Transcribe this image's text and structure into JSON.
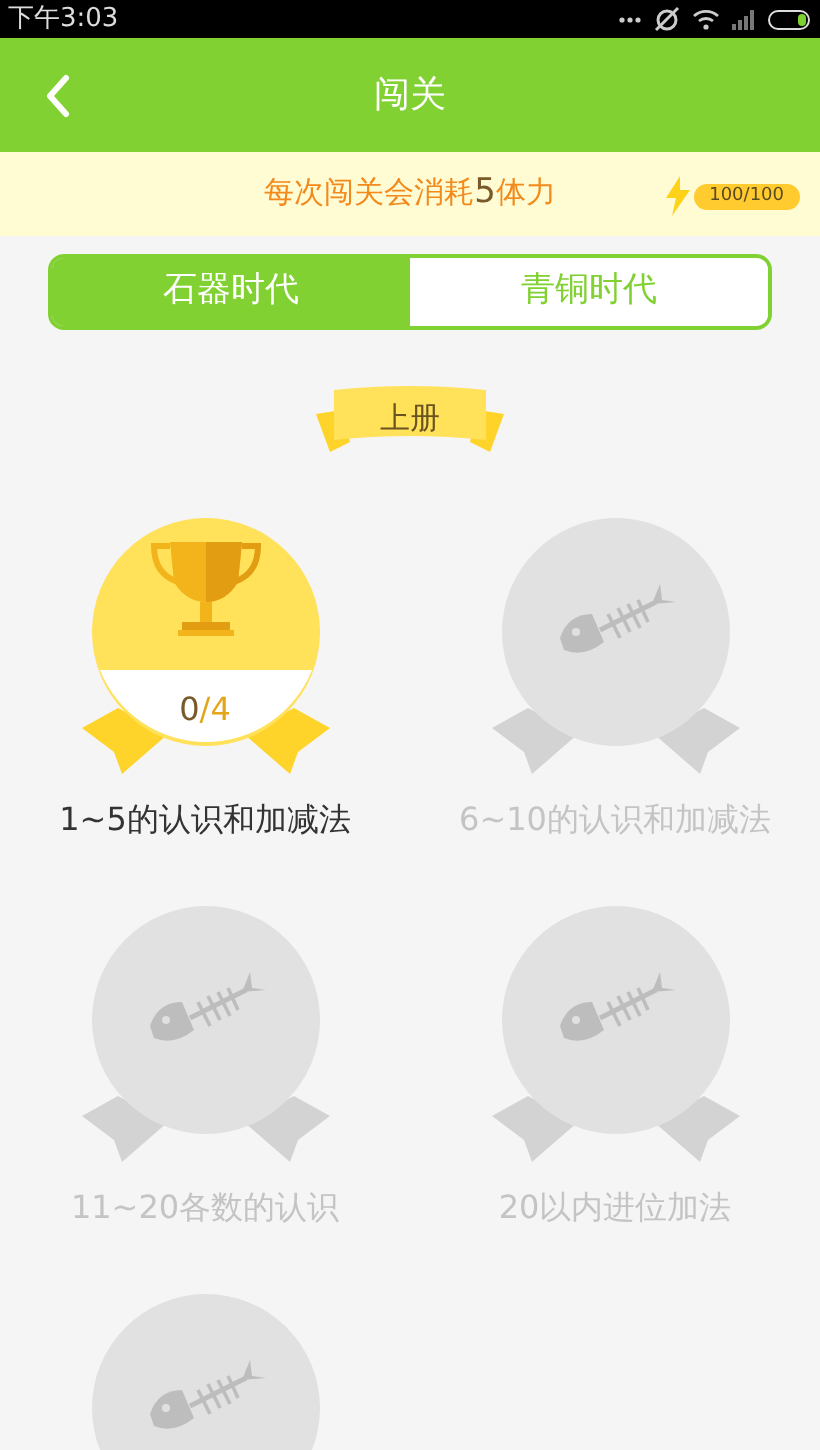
{
  "status_bar": {
    "time": "下午3:03"
  },
  "header": {
    "title": "闯关"
  },
  "banner": {
    "text": "每次闯关会消耗**5**体力",
    "energy": "100/100"
  },
  "tabs": [
    {
      "label": "石器时代",
      "selected": true
    },
    {
      "label": "青铜时代",
      "selected": false
    }
  ],
  "volume": {
    "label": "上册"
  },
  "levels": [
    {
      "kind": "unlocked",
      "progress_done": "0",
      "progress_rest": "/4",
      "label": "1~5的认识和加减法"
    },
    {
      "kind": "locked",
      "label": "6~10的认识和加减法"
    },
    {
      "kind": "locked",
      "label": "11~20各数的认识"
    },
    {
      "kind": "locked",
      "label": "20以内进位加法"
    },
    {
      "kind": "locked"
    }
  ]
}
